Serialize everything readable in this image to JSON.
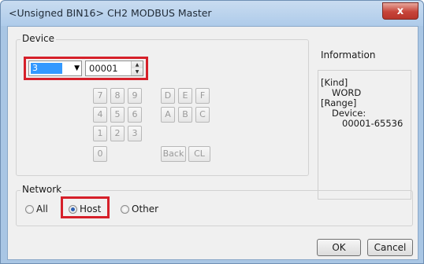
{
  "window": {
    "title": "<Unsigned BIN16> CH2 MODBUS Master",
    "close_glyph": "x"
  },
  "device": {
    "label": "Device",
    "type_select": {
      "value": "3",
      "arrow": "▼"
    },
    "address": {
      "value": "00001",
      "up": "▲",
      "down": "▼"
    },
    "keypad": {
      "digits": [
        "7",
        "8",
        "9",
        "4",
        "5",
        "6",
        "1",
        "2",
        "3",
        "0"
      ],
      "hex": [
        "D",
        "E",
        "F",
        "A",
        "B",
        "C"
      ],
      "back_label": "Back",
      "clear_label": "CL"
    }
  },
  "information": {
    "title": "Information",
    "kind_label": "[Kind]",
    "kind_value": "WORD",
    "range_label": "[Range]",
    "range_device_label": "Device:",
    "range_device_value": "00001-65536"
  },
  "network": {
    "label": "Network",
    "options": [
      {
        "label": "All",
        "checked": false
      },
      {
        "label": "Host",
        "checked": true
      },
      {
        "label": "Other",
        "checked": false
      }
    ]
  },
  "footer": {
    "ok_label": "OK",
    "cancel_label": "Cancel"
  },
  "colors": {
    "highlight_border": "#d6202a",
    "selection": "#3399ff",
    "window_frame": "#a9c6e4",
    "close_button": "#c7453a"
  },
  "icons": {
    "close": "close-icon",
    "dropdown": "chevron-down-icon",
    "spin_up": "chevron-up-icon",
    "spin_down": "chevron-down-icon"
  }
}
